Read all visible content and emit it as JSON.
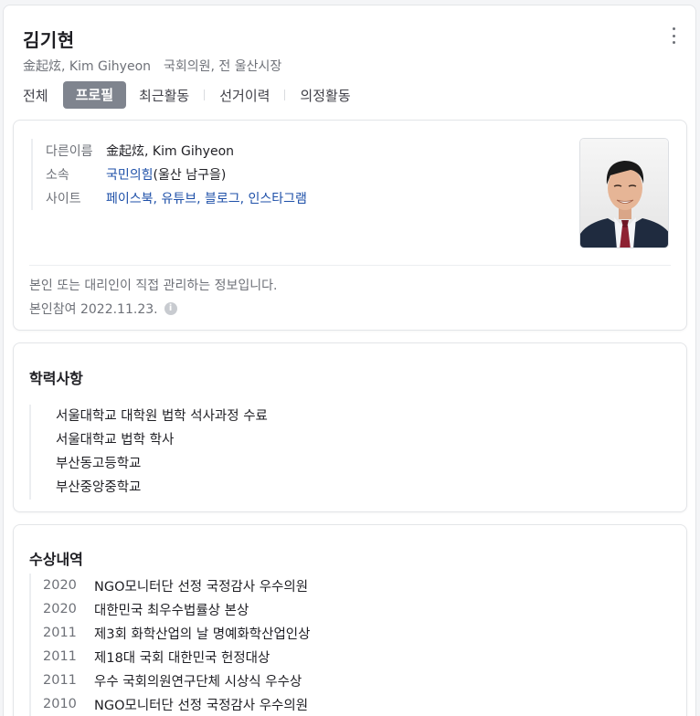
{
  "header": {
    "name": "김기현",
    "hanja_roman": "金起炫, Kim Gihyeon",
    "role": "국회의원, 전 울산시장"
  },
  "tabs": [
    {
      "label": "전체",
      "active": false
    },
    {
      "label": "프로필",
      "active": true
    },
    {
      "label": "최근활동",
      "active": false
    },
    {
      "label": "선거이력",
      "active": false
    },
    {
      "label": "의정활동",
      "active": false
    }
  ],
  "profile": {
    "alias_label": "다른이름",
    "alias_value": "金起炫, Kim Gihyeon",
    "affiliation_label": "소속",
    "affiliation_party": "국민의힘",
    "affiliation_district": "(울산 남구을)",
    "site_label": "사이트",
    "sites": [
      "페이스북",
      "유튜브",
      "블로그",
      "인스타그램"
    ],
    "site_separator": ", ",
    "notice": "본인 또는 대리인이 직접 관리하는 정보입니다.",
    "verified_date": "본인참여 2022.11.23.",
    "info_icon_glyph": "i"
  },
  "education": {
    "title": "학력사항",
    "items": [
      "서울대학교 대학원 법학 석사과정 수료",
      "서울대학교 법학 학사",
      "부산동고등학교",
      "부산중앙중학교"
    ]
  },
  "awards": {
    "title": "수상내역",
    "items": [
      {
        "year": "2020",
        "text": "NGO모니터단 선정 국정감사 우수의원"
      },
      {
        "year": "2020",
        "text": "대한민국 최우수법률상 본상"
      },
      {
        "year": "2011",
        "text": "제3회 화학산업의 날 명예화학산업인상"
      },
      {
        "year": "2011",
        "text": "제18대 국회 대한민국 헌정대상"
      },
      {
        "year": "2011",
        "text": "우수 국회의원연구단체 시상식 우수상"
      },
      {
        "year": "2010",
        "text": "NGO모니터단 선정 국정감사 우수의원"
      }
    ]
  },
  "colors": {
    "link": "#1d4fa8",
    "active_tab_bg": "#7f848e",
    "muted_text": "#6e7178"
  },
  "icons": {
    "more": "more-vertical-icon",
    "info": "info-icon"
  }
}
